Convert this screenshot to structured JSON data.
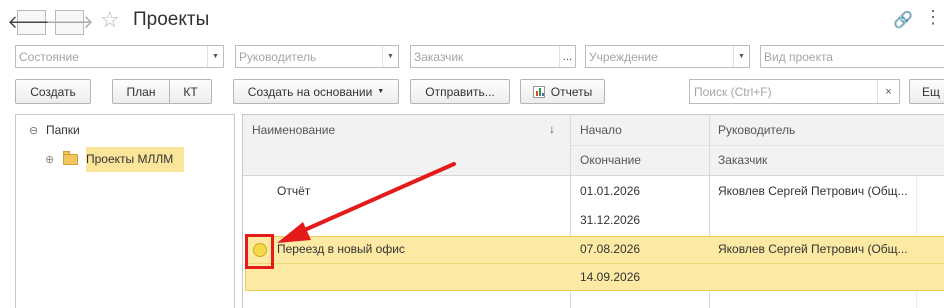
{
  "window": {
    "title": "Проекты",
    "nav_back": "🡐",
    "nav_forward": "🡒",
    "favorite_icon": "☆",
    "link_icon": "🔗",
    "more_icon": "⋮"
  },
  "filters": [
    {
      "placeholder": "Состояние",
      "control": "dropdown"
    },
    {
      "placeholder": "Руководитель",
      "control": "dropdown"
    },
    {
      "placeholder": "Заказчик",
      "control": "choice"
    },
    {
      "placeholder": "Учреждение",
      "control": "dropdown"
    },
    {
      "placeholder": "Вид проекта",
      "control": "dropdown"
    }
  ],
  "toolbar": {
    "create": "Создать",
    "plan": "План",
    "kt": "КТ",
    "create_based_on": "Создать на основании",
    "send": "Отправить...",
    "reports": "Отчеты",
    "search_placeholder": "Поиск (Ctrl+F)",
    "search_clear": "×",
    "more": "Ещ"
  },
  "tree": {
    "root": {
      "label": "Папки",
      "toggle": "⊖"
    },
    "children": [
      {
        "label": "Проекты МЛЛМ",
        "toggle": "⊕",
        "selected": true
      }
    ]
  },
  "table": {
    "columns": {
      "name": "Наименование",
      "sort": "↓",
      "start": "Начало",
      "end": "Окончание",
      "manager": "Руководитель",
      "customer": "Заказчик"
    },
    "rows": [
      {
        "name": "Отчёт",
        "start": "01.01.2026",
        "end": "31.12.2026",
        "manager": "Яковлев Сергей Петрович (Общ...",
        "customer": "",
        "status_icon": false,
        "selected": false
      },
      {
        "name": "Переезд в новый офис",
        "start": "07.08.2026",
        "end": "14.09.2026",
        "manager": "Яковлев Сергей Петрович (Общ...",
        "customer": "",
        "status_icon": true,
        "selected": true
      }
    ]
  },
  "colors": {
    "selection": "#fce9a4",
    "annotation": "#e31b1b",
    "status": "#f5d94b"
  }
}
